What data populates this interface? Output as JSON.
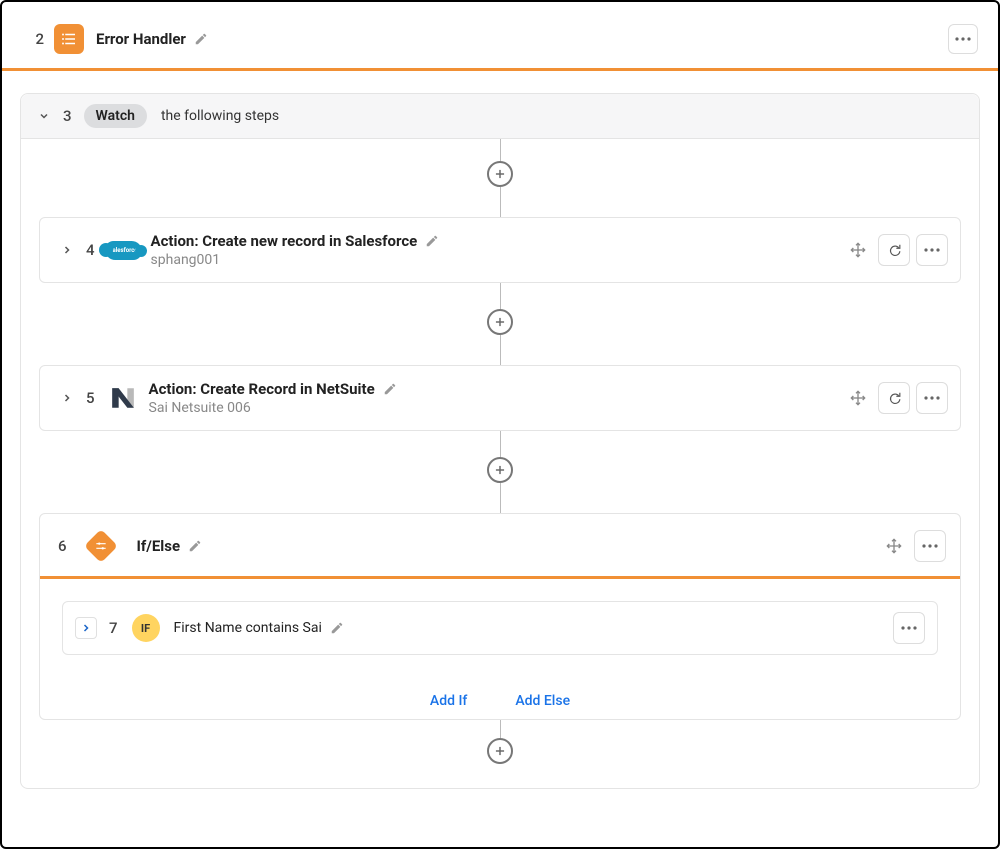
{
  "errorHandler": {
    "number": "2",
    "title": "Error Handler"
  },
  "watch": {
    "number": "3",
    "badge": "Watch",
    "description": "the following steps"
  },
  "steps": [
    {
      "number": "4",
      "title": "Action: Create new record in Salesforce",
      "subtitle": "sphang001"
    },
    {
      "number": "5",
      "title": "Action: Create Record in NetSuite",
      "subtitle": "Sai Netsuite 006"
    }
  ],
  "ifElse": {
    "number": "6",
    "title": "If/Else",
    "row": {
      "number": "7",
      "badge": "IF",
      "text": "First Name contains Sai"
    },
    "addIf": "Add If",
    "addElse": "Add Else"
  }
}
